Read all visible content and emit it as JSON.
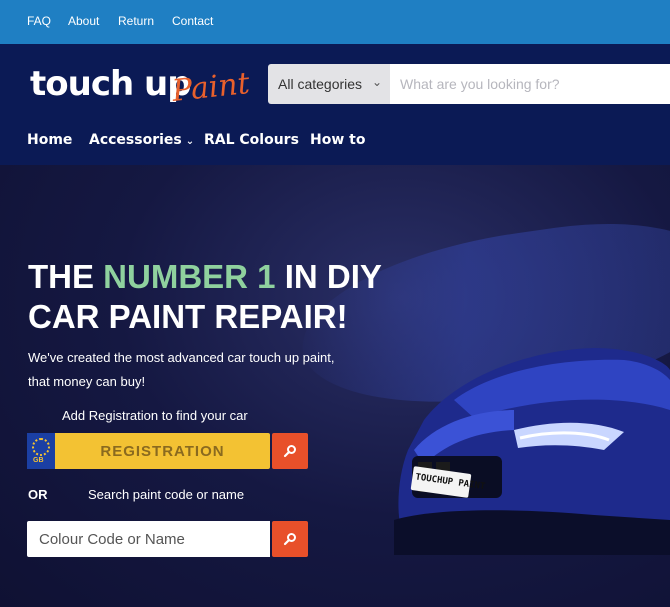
{
  "topbar": {
    "links": [
      "FAQ",
      "About",
      "Return",
      "Contact"
    ]
  },
  "header": {
    "logo_main": "touch up",
    "logo_script": "Paint",
    "category_select": "All categories",
    "search_placeholder": "What are you looking for?",
    "nav": {
      "home": "Home",
      "accessories": "Accessories",
      "ral": "RAL Colours",
      "howto": "How to"
    }
  },
  "hero": {
    "headline_1a": "THE ",
    "headline_1b": "NUMBER 1",
    "headline_1c": " IN DIY",
    "headline_2": "CAR PAINT REPAIR!",
    "subtext_1": "We've created the most advanced car touch up paint,",
    "subtext_2": "that money can buy!",
    "add_registration": "Add Registration to find your car",
    "plate_country": "GB",
    "registration_placeholder": "REGISTRATION",
    "or_label": "OR",
    "search_code_label": "Search paint code or name",
    "colour_placeholder": "Colour Code or Name",
    "car_plate_text": "TOUCHUP PAINT"
  },
  "colors": {
    "topbar": "#1f7fc3",
    "header": "#0b1a55",
    "accent_orange": "#e8502a",
    "plate_yellow": "#f3c233",
    "headline_green": "#8fd19e"
  },
  "icons": {
    "search_button": "search-icon",
    "category_chevron": "chevron-down-icon"
  }
}
